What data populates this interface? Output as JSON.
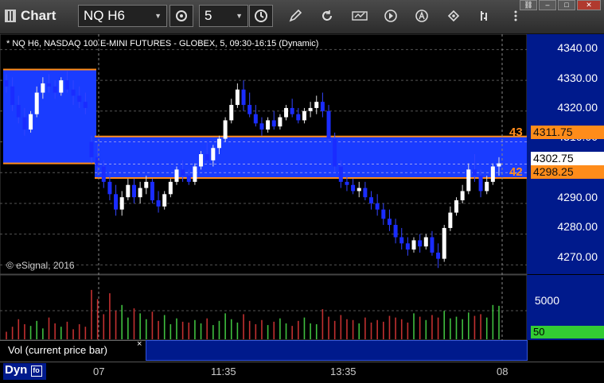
{
  "toolbar": {
    "title": "Chart",
    "symbol": "NQ H6",
    "interval": "5"
  },
  "chart_info": {
    "description": "* NQ H6, NASDAQ 100 E-MINI FUTURES - GLOBEX, 5, 09:30-16:15 (Dynamic)",
    "copyright": "© eSignal, 2016"
  },
  "price_axis": {
    "labels": [
      "4340.00",
      "4330.00",
      "4320.00",
      "4310.00",
      "4290.00",
      "4280.00",
      "4270.00"
    ],
    "upper_marker_label": "43",
    "upper_marker_price": "4311.75",
    "current_price": "4302.75",
    "lower_marker_label": "42",
    "lower_marker_price": "4298.25"
  },
  "volume_axis": {
    "label": "5000",
    "current_volume": "50"
  },
  "volume_panel": {
    "label": "Vol (current price bar)",
    "close": "×"
  },
  "time_axis": {
    "labels": [
      "07",
      "11:35",
      "13:35",
      "08"
    ],
    "mode": "Dyn"
  },
  "colors": {
    "zone_fill": "#1a3cff",
    "zone_line": "#ff8c1a",
    "up_candle": "#ffffff",
    "down_candle": "#1a2cff",
    "vol_up": "#3fbf3f",
    "vol_down": "#c23030",
    "volume_badge": "#33cc33"
  },
  "chart_data": {
    "type": "candlestick",
    "ylim": [
      4267,
      4345
    ],
    "zones": [
      {
        "from": 4303,
        "to": 4333.5,
        "span": "left"
      },
      {
        "from": 4298.25,
        "to": 4311.75,
        "span": "right"
      }
    ],
    "candles": [
      [
        4330,
        4332,
        4326,
        4328
      ],
      [
        4328,
        4331,
        4320,
        4322
      ],
      [
        4322,
        4325,
        4316,
        4318
      ],
      [
        4318,
        4321,
        4312,
        4314
      ],
      [
        4314,
        4320,
        4313,
        4319
      ],
      [
        4319,
        4328,
        4318,
        4326
      ],
      [
        4326,
        4331,
        4324,
        4329
      ],
      [
        4329,
        4332,
        4326,
        4328
      ],
      [
        4328,
        4330,
        4324,
        4326
      ],
      [
        4326,
        4331,
        4325,
        4330
      ],
      [
        4330,
        4333,
        4326,
        4327
      ],
      [
        4327,
        4330,
        4322,
        4325
      ],
      [
        4325,
        4328,
        4321,
        4323
      ],
      [
        4323,
        4326,
        4319,
        4321
      ],
      [
        4310,
        4312,
        4303,
        4305
      ],
      [
        4305,
        4309,
        4299,
        4302
      ],
      [
        4302,
        4304,
        4295,
        4297
      ],
      [
        4297,
        4300,
        4291,
        4293
      ],
      [
        4293,
        4296,
        4286,
        4288
      ],
      [
        4288,
        4294,
        4286,
        4292
      ],
      [
        4292,
        4298,
        4291,
        4296
      ],
      [
        4296,
        4298,
        4290,
        4292
      ],
      [
        4292,
        4297,
        4290,
        4295
      ],
      [
        4295,
        4299,
        4293,
        4297
      ],
      [
        4297,
        4298,
        4290,
        4291
      ],
      [
        4291,
        4294,
        4287,
        4289
      ],
      [
        4289,
        4294,
        4288,
        4293
      ],
      [
        4293,
        4298,
        4292,
        4297
      ],
      [
        4297,
        4302,
        4296,
        4301
      ],
      [
        4301,
        4304,
        4297,
        4299
      ],
      [
        4299,
        4301,
        4296,
        4297
      ],
      [
        4297,
        4303,
        4296,
        4302
      ],
      [
        4302,
        4307,
        4301,
        4306
      ],
      [
        4306,
        4310,
        4303,
        4304
      ],
      [
        4304,
        4309,
        4302,
        4308
      ],
      [
        4308,
        4312,
        4306,
        4311
      ],
      [
        4311,
        4318,
        4310,
        4317
      ],
      [
        4317,
        4324,
        4316,
        4322
      ],
      [
        4322,
        4329,
        4321,
        4327
      ],
      [
        4327,
        4330,
        4320,
        4322
      ],
      [
        4322,
        4326,
        4318,
        4319
      ],
      [
        4319,
        4322,
        4315,
        4316
      ],
      [
        4316,
        4318,
        4312,
        4314
      ],
      [
        4314,
        4318,
        4313,
        4317
      ],
      [
        4317,
        4320,
        4314,
        4315
      ],
      [
        4315,
        4319,
        4314,
        4318
      ],
      [
        4318,
        4322,
        4317,
        4321
      ],
      [
        4321,
        4324,
        4318,
        4319
      ],
      [
        4319,
        4321,
        4316,
        4317
      ],
      [
        4317,
        4321,
        4316,
        4320
      ],
      [
        4320,
        4323,
        4318,
        4321
      ],
      [
        4321,
        4325,
        4319,
        4323
      ],
      [
        4323,
        4326,
        4318,
        4320
      ],
      [
        4320,
        4322,
        4310,
        4311
      ],
      [
        4311,
        4313,
        4300,
        4302
      ],
      [
        4302,
        4304,
        4295,
        4297
      ],
      [
        4297,
        4299,
        4294,
        4296
      ],
      [
        4296,
        4298,
        4293,
        4294
      ],
      [
        4294,
        4297,
        4292,
        4295
      ],
      [
        4295,
        4297,
        4291,
        4292
      ],
      [
        4292,
        4294,
        4288,
        4290
      ],
      [
        4290,
        4293,
        4286,
        4288
      ],
      [
        4288,
        4290,
        4283,
        4285
      ],
      [
        4285,
        4288,
        4281,
        4283
      ],
      [
        4283,
        4285,
        4277,
        4279
      ],
      [
        4279,
        4282,
        4275,
        4277
      ],
      [
        4277,
        4279,
        4273,
        4275
      ],
      [
        4275,
        4279,
        4274,
        4278
      ],
      [
        4278,
        4280,
        4274,
        4276
      ],
      [
        4276,
        4280,
        4275,
        4279
      ],
      [
        4279,
        4281,
        4273,
        4274
      ],
      [
        4274,
        4277,
        4269,
        4272
      ],
      [
        4272,
        4283,
        4271,
        4282
      ],
      [
        4282,
        4289,
        4281,
        4287
      ],
      [
        4287,
        4292,
        4286,
        4291
      ],
      [
        4291,
        4296,
        4290,
        4294
      ],
      [
        4294,
        4303,
        4293,
        4301
      ],
      [
        4301,
        4306,
        4297,
        4299
      ],
      [
        4299,
        4301,
        4292,
        4294
      ],
      [
        4294,
        4299,
        4293,
        4297
      ],
      [
        4297,
        4303,
        4296,
        4302
      ],
      [
        4302,
        4305,
        4299,
        4303
      ]
    ],
    "volume_ylim": [
      0,
      7500
    ],
    "volume": [
      900,
      1500,
      2400,
      1800,
      1600,
      2200,
      1300,
      2600,
      1900,
      1500,
      2100,
      1200,
      1800,
      1500,
      5900,
      4800,
      3000,
      5500,
      3400,
      4100,
      2600,
      3700,
      3100,
      2400,
      3300,
      2200,
      2900,
      1800,
      2500,
      2100,
      2000,
      2300,
      1900,
      2500,
      1700,
      2200,
      3100,
      2400,
      2000,
      3000,
      2200,
      1800,
      2300,
      1700,
      2100,
      2500,
      1900,
      1600,
      2200,
      2600,
      1900,
      1800,
      3600,
      2700,
      2200,
      2900,
      2400,
      2300,
      1900,
      2600,
      2000,
      2300,
      2100,
      2800,
      2600,
      2400,
      2000,
      3100,
      2700,
      2300,
      2900,
      2600,
      3400,
      2500,
      2700,
      2400,
      3200,
      2800,
      3000,
      2600,
      4100,
      4000
    ]
  }
}
